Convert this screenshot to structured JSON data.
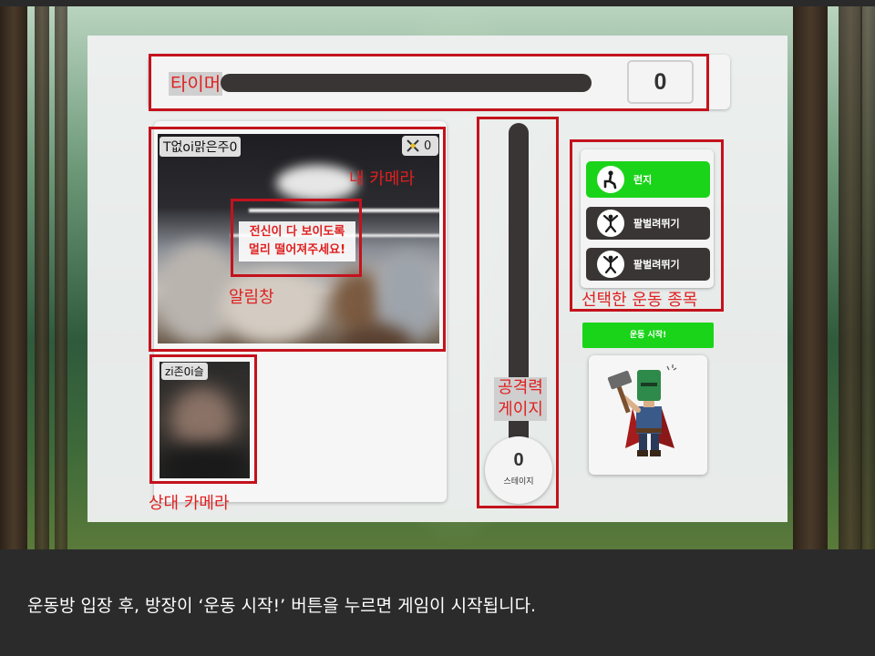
{
  "timer": {
    "label": "타이머",
    "count": "0"
  },
  "my_camera": {
    "annotation": "내 카메라",
    "username": "T없oi맑은주0",
    "score": "0",
    "alert_lines": [
      "전신이 다 보이도록",
      "멀리 떨어져주세요!"
    ],
    "alert_annotation": "알림창"
  },
  "opponent_camera": {
    "annotation": "상대 카메라",
    "username": "zi존0i슬"
  },
  "gauge": {
    "label_line1": "공격력",
    "label_line2": "게이지",
    "stage_number": "0",
    "stage_label": "스테이지"
  },
  "exercises": {
    "annotation": "선택한 운동 종목",
    "items": [
      {
        "label": "런지",
        "color": "#1ad41a",
        "icon": "lunge-icon"
      },
      {
        "label": "팔벌려뛰기",
        "color": "#3a3535",
        "icon": "jumping-jack-icon"
      },
      {
        "label": "팔벌려뛰기",
        "color": "#3a3535",
        "icon": "jumping-jack-icon"
      }
    ]
  },
  "start_button": {
    "label": "운동 시작!"
  },
  "caption": "운동방 입장 후, 방장이 ‘운동 시작!’ 버튼을 누르면 게임이 시작됩니다."
}
